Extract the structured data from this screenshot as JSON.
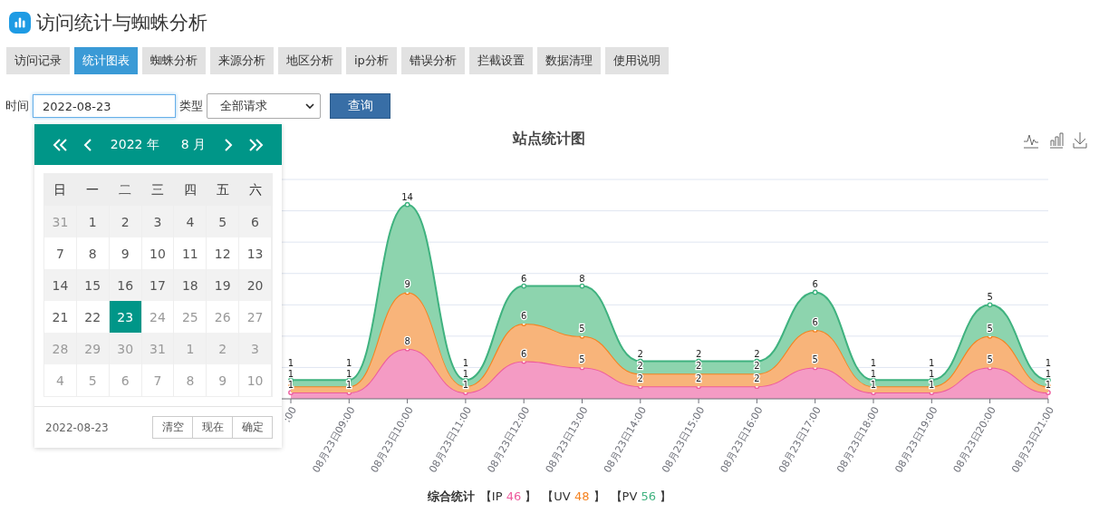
{
  "page": {
    "title": "访问统计与蜘蛛分析"
  },
  "tabs": [
    {
      "label": "访问记录",
      "selected": false
    },
    {
      "label": "统计图表",
      "selected": true
    },
    {
      "label": "蜘蛛分析",
      "selected": false
    },
    {
      "label": "来源分析",
      "selected": false
    },
    {
      "label": "地区分析",
      "selected": false
    },
    {
      "label": "ip分析",
      "selected": false
    },
    {
      "label": "错误分析",
      "selected": false
    },
    {
      "label": "拦截设置",
      "selected": false
    },
    {
      "label": "数据清理",
      "selected": false
    },
    {
      "label": "使用说明",
      "selected": false
    }
  ],
  "filter": {
    "time_label": "时间",
    "time_value": "2022-08-23",
    "type_label": "类型",
    "type_value": "全部请求",
    "query_button": "查询"
  },
  "calendar": {
    "year": "2022 年",
    "month": "8 月",
    "weekdays": [
      "日",
      "一",
      "二",
      "三",
      "四",
      "五",
      "六"
    ],
    "weeks": [
      [
        {
          "day": "31",
          "kind": "other"
        },
        {
          "day": "1",
          "kind": "current"
        },
        {
          "day": "2",
          "kind": "current"
        },
        {
          "day": "3",
          "kind": "current"
        },
        {
          "day": "4",
          "kind": "current"
        },
        {
          "day": "5",
          "kind": "current"
        },
        {
          "day": "6",
          "kind": "current"
        }
      ],
      [
        {
          "day": "7",
          "kind": "current"
        },
        {
          "day": "8",
          "kind": "current"
        },
        {
          "day": "9",
          "kind": "current"
        },
        {
          "day": "10",
          "kind": "current"
        },
        {
          "day": "11",
          "kind": "current"
        },
        {
          "day": "12",
          "kind": "current"
        },
        {
          "day": "13",
          "kind": "current"
        }
      ],
      [
        {
          "day": "14",
          "kind": "current"
        },
        {
          "day": "15",
          "kind": "current"
        },
        {
          "day": "16",
          "kind": "current"
        },
        {
          "day": "17",
          "kind": "current"
        },
        {
          "day": "18",
          "kind": "current"
        },
        {
          "day": "19",
          "kind": "current"
        },
        {
          "day": "20",
          "kind": "current"
        }
      ],
      [
        {
          "day": "21",
          "kind": "current"
        },
        {
          "day": "22",
          "kind": "current"
        },
        {
          "day": "23",
          "kind": "selected"
        },
        {
          "day": "24",
          "kind": "disabled"
        },
        {
          "day": "25",
          "kind": "disabled"
        },
        {
          "day": "26",
          "kind": "disabled"
        },
        {
          "day": "27",
          "kind": "disabled"
        }
      ],
      [
        {
          "day": "28",
          "kind": "disabled"
        },
        {
          "day": "29",
          "kind": "disabled"
        },
        {
          "day": "30",
          "kind": "disabled"
        },
        {
          "day": "31",
          "kind": "disabled"
        },
        {
          "day": "1",
          "kind": "other"
        },
        {
          "day": "2",
          "kind": "other"
        },
        {
          "day": "3",
          "kind": "other"
        }
      ],
      [
        {
          "day": "4",
          "kind": "other"
        },
        {
          "day": "5",
          "kind": "other"
        },
        {
          "day": "6",
          "kind": "other"
        },
        {
          "day": "7",
          "kind": "other"
        },
        {
          "day": "8",
          "kind": "other"
        },
        {
          "day": "9",
          "kind": "other"
        },
        {
          "day": "10",
          "kind": "other"
        }
      ]
    ],
    "footer_value": "2022-08-23",
    "buttons": [
      "清空",
      "现在",
      "确定"
    ]
  },
  "chart": {
    "chart_data": {
      "type": "area",
      "title": "站点统计图",
      "stacked": true,
      "data_labels": true,
      "ylim": [
        0,
        35
      ],
      "categories": [
        ":00",
        "08月23日09:00",
        "08月23日10:00",
        "08月23日11:00",
        "08月23日12:00",
        "08月23日13:00",
        "08月23日14:00",
        "08月23日15:00",
        "08月23日16:00",
        "08月23日17:00",
        "08月23日18:00",
        "08月23日19:00",
        "08月23日20:00",
        "08月23日21:00"
      ],
      "series": [
        {
          "name": "IP",
          "color": "#ee5b9d",
          "values": [
            1,
            1,
            8,
            1,
            6,
            5,
            2,
            2,
            2,
            5,
            1,
            1,
            5,
            1
          ]
        },
        {
          "name": "UV",
          "color": "#f5821f",
          "values": [
            1,
            1,
            9,
            1,
            6,
            5,
            2,
            2,
            2,
            6,
            1,
            1,
            5,
            1
          ]
        },
        {
          "name": "PV",
          "color": "#3fb27f",
          "values": [
            1,
            1,
            14,
            1,
            6,
            8,
            2,
            2,
            2,
            6,
            1,
            1,
            5,
            1
          ]
        }
      ]
    },
    "legend": {
      "label": "综合统计",
      "items": [
        {
          "open": "【",
          "total": "46",
          "close": "】"
        },
        {
          "open": "【",
          "total": "48",
          "close": "】"
        },
        {
          "open": "【",
          "total": "56",
          "close": "】"
        }
      ]
    }
  }
}
